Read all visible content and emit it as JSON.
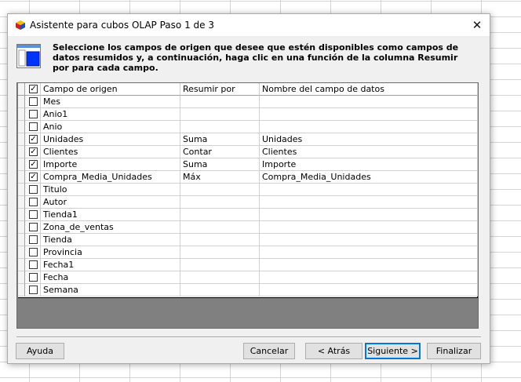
{
  "dialog": {
    "title": "Asistente para cubos OLAP Paso 1 de 3",
    "close_glyph": "✕",
    "instructions": "Seleccione los campos de origen que desee que estén disponibles como campos de datos resumidos y, a continuación, haga clic en una función de la columna Resumir por para cada campo."
  },
  "grid": {
    "header": {
      "checked": true,
      "columns": [
        "Campo de origen",
        "Resumir por",
        "Nombre del campo de datos"
      ]
    },
    "rows": [
      {
        "checked": false,
        "field": "Mes",
        "summarize": "",
        "name": ""
      },
      {
        "checked": false,
        "field": "Anio1",
        "summarize": "",
        "name": ""
      },
      {
        "checked": false,
        "field": "Anio",
        "summarize": "",
        "name": ""
      },
      {
        "checked": true,
        "field": "Unidades",
        "summarize": "Suma",
        "name": "Unidades"
      },
      {
        "checked": true,
        "field": "Clientes",
        "summarize": "Contar",
        "name": "Clientes"
      },
      {
        "checked": true,
        "field": "Importe",
        "summarize": "Suma",
        "name": "Importe"
      },
      {
        "checked": true,
        "field": "Compra_Media_Unidades",
        "summarize": "Máx",
        "name": "Compra_Media_Unidades"
      },
      {
        "checked": false,
        "field": "Titulo",
        "summarize": "",
        "name": ""
      },
      {
        "checked": false,
        "field": "Autor",
        "summarize": "",
        "name": ""
      },
      {
        "checked": false,
        "field": "Tienda1",
        "summarize": "",
        "name": ""
      },
      {
        "checked": false,
        "field": "Zona_de_ventas",
        "summarize": "",
        "name": ""
      },
      {
        "checked": false,
        "field": "Tienda",
        "summarize": "",
        "name": ""
      },
      {
        "checked": false,
        "field": "Provincia",
        "summarize": "",
        "name": ""
      },
      {
        "checked": false,
        "field": "Fecha1",
        "summarize": "",
        "name": ""
      },
      {
        "checked": false,
        "field": "Fecha",
        "summarize": "",
        "name": ""
      },
      {
        "checked": false,
        "field": "Semana",
        "summarize": "",
        "name": ""
      }
    ]
  },
  "buttons": {
    "help": "Ayuda",
    "cancel": "Cancelar",
    "back": "< Atrás",
    "next": "Siguiente >",
    "finish": "Finalizar"
  },
  "colors": {
    "accent": "#0078d7",
    "grid_empty": "#808080",
    "dialog_bg": "#f0f0f0"
  }
}
